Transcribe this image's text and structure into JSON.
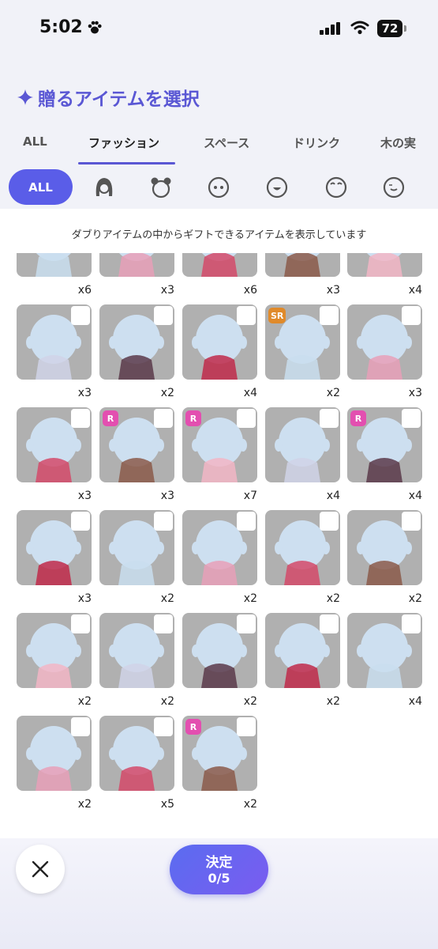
{
  "status": {
    "time": "5:02",
    "battery": "72"
  },
  "header": {
    "title": "贈るアイテムを選択"
  },
  "tabs": [
    {
      "label": "ALL",
      "active": false
    },
    {
      "label": "ファッション",
      "active": true
    },
    {
      "label": "スペース",
      "active": false
    },
    {
      "label": "ドリンク",
      "active": false
    },
    {
      "label": "木の実",
      "active": false
    }
  ],
  "filters": {
    "all_label": "ALL",
    "categories": [
      "hair-icon",
      "animal-ears-icon",
      "face-eyes-icon",
      "face-mouth-icon",
      "face-brows-icon",
      "face-blush-icon"
    ]
  },
  "notice": "ダブりアイテムの中からギフトできるアイテムを表示しています",
  "items": [
    {
      "count": "x6",
      "rarity": "",
      "icon": "bracelet-icon"
    },
    {
      "count": "x3",
      "rarity": "",
      "icon": "legs-icon"
    },
    {
      "count": "x6",
      "rarity": "",
      "icon": "black-top-icon"
    },
    {
      "count": "x3",
      "rarity": "",
      "icon": "necklace-icon"
    },
    {
      "count": "x4",
      "rarity": "",
      "icon": "phone-case-icon"
    },
    {
      "count": "x3",
      "rarity": "",
      "icon": "cherry-earrings-icon"
    },
    {
      "count": "x2",
      "rarity": "",
      "icon": "red-frill-skirt-icon"
    },
    {
      "count": "x4",
      "rarity": "",
      "icon": "plaid-top-icon"
    },
    {
      "count": "x2",
      "rarity": "SR",
      "icon": "brown-bun-hair-icon"
    },
    {
      "count": "x3",
      "rarity": "",
      "icon": "heart-glasses-icon"
    },
    {
      "count": "x3",
      "rarity": "",
      "icon": "red-jacket-icon"
    },
    {
      "count": "x3",
      "rarity": "R",
      "icon": "polka-dress-icon"
    },
    {
      "count": "x7",
      "rarity": "R",
      "icon": "red-heels-icon"
    },
    {
      "count": "x4",
      "rarity": "",
      "icon": "checked-top-icon"
    },
    {
      "count": "x4",
      "rarity": "R",
      "icon": "lips-icon"
    },
    {
      "count": "x3",
      "rarity": "",
      "icon": "red-sneakers-icon"
    },
    {
      "count": "x2",
      "rarity": "",
      "icon": "white-socks-icon"
    },
    {
      "count": "x2",
      "rarity": "",
      "icon": "dark-frill-skirt-icon"
    },
    {
      "count": "x2",
      "rarity": "",
      "icon": "heart-lollipop-icon"
    },
    {
      "count": "x2",
      "rarity": "",
      "icon": "pink-headband-icon"
    },
    {
      "count": "x2",
      "rarity": "",
      "icon": "blush-icon"
    },
    {
      "count": "x2",
      "rarity": "",
      "icon": "eye-patch-icon"
    },
    {
      "count": "x2",
      "rarity": "",
      "icon": "plaid-skirt-icon"
    },
    {
      "count": "x2",
      "rarity": "",
      "icon": "black-shorts-icon"
    },
    {
      "count": "x4",
      "rarity": "",
      "icon": "striped-socks-icon"
    },
    {
      "count": "x2",
      "rarity": "",
      "icon": "face-icon"
    },
    {
      "count": "x5",
      "rarity": "",
      "icon": "white-tulle-skirt-icon"
    },
    {
      "count": "x2",
      "rarity": "R",
      "icon": "headphones-icon"
    }
  ],
  "footer": {
    "confirm_label": "決定",
    "selection": "0/5"
  },
  "colors": {
    "accent": "#5a57d4",
    "chip": "#5a5de8",
    "rarity_r": "#e34fb0",
    "rarity_sr": "#e08a2a",
    "tile": "#b0b0b0"
  }
}
